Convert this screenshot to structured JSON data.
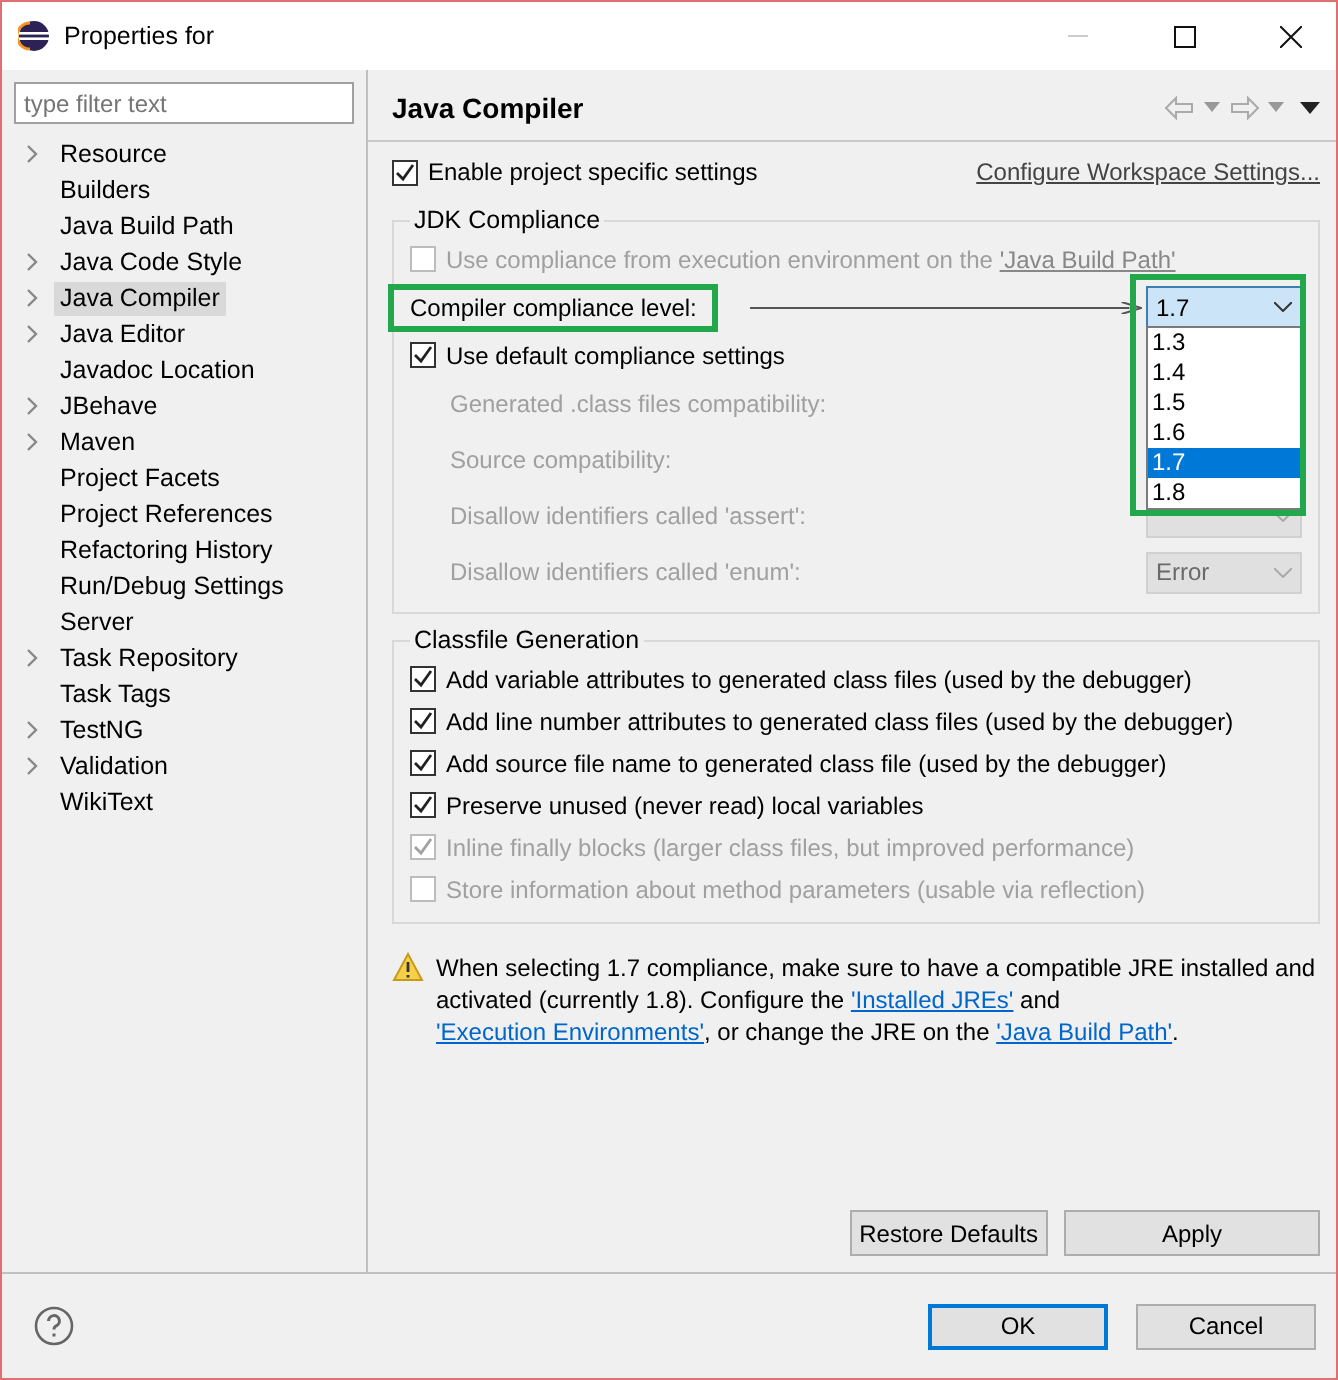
{
  "window": {
    "title": "Properties for"
  },
  "filter": {
    "placeholder": "type filter text"
  },
  "sidebar": {
    "items": [
      {
        "label": "Resource",
        "expandable": true,
        "selected": false
      },
      {
        "label": "Builders",
        "expandable": false,
        "selected": false
      },
      {
        "label": "Java Build Path",
        "expandable": false,
        "selected": false
      },
      {
        "label": "Java Code Style",
        "expandable": true,
        "selected": false
      },
      {
        "label": "Java Compiler",
        "expandable": true,
        "selected": true
      },
      {
        "label": "Java Editor",
        "expandable": true,
        "selected": false
      },
      {
        "label": "Javadoc Location",
        "expandable": false,
        "selected": false
      },
      {
        "label": "JBehave",
        "expandable": true,
        "selected": false
      },
      {
        "label": "Maven",
        "expandable": true,
        "selected": false
      },
      {
        "label": "Project Facets",
        "expandable": false,
        "selected": false
      },
      {
        "label": "Project References",
        "expandable": false,
        "selected": false
      },
      {
        "label": "Refactoring History",
        "expandable": false,
        "selected": false
      },
      {
        "label": "Run/Debug Settings",
        "expandable": false,
        "selected": false
      },
      {
        "label": "Server",
        "expandable": false,
        "selected": false
      },
      {
        "label": "Task Repository",
        "expandable": true,
        "selected": false
      },
      {
        "label": "Task Tags",
        "expandable": false,
        "selected": false
      },
      {
        "label": "TestNG",
        "expandable": true,
        "selected": false
      },
      {
        "label": "Validation",
        "expandable": true,
        "selected": false
      },
      {
        "label": "WikiText",
        "expandable": false,
        "selected": false
      }
    ]
  },
  "page": {
    "title": "Java Compiler",
    "enable": {
      "label": "Enable project specific settings",
      "checked": true
    },
    "configure_link": "Configure Workspace Settings...",
    "jdk_compliance": {
      "title": "JDK Compliance",
      "use_execution_env": {
        "label": "Use compliance from execution environment on the ",
        "link": "'Java Build Path'",
        "checked": false,
        "disabled": true
      },
      "compliance_level": {
        "label": "Compiler compliance level:",
        "value": "1.7",
        "expanded": true,
        "options": [
          {
            "label": "1.3",
            "selected": false
          },
          {
            "label": "1.4",
            "selected": false
          },
          {
            "label": "1.5",
            "selected": false
          },
          {
            "label": "1.6",
            "selected": false
          },
          {
            "label": "1.7",
            "selected": true
          },
          {
            "label": "1.8",
            "selected": false
          }
        ]
      },
      "use_default": {
        "label": "Use default compliance settings",
        "checked": true
      },
      "settings": [
        {
          "kind": "label",
          "label": "Generated .class files compatibility:",
          "disabled": true
        },
        {
          "kind": "label",
          "label": "Source compatibility:",
          "disabled": true
        },
        {
          "kind": "dropdown",
          "label": "Disallow identifiers called 'assert':",
          "disabled": true
        },
        {
          "kind": "dropdown",
          "label": "Disallow identifiers called 'enum':",
          "disabled": true,
          "value": "Error"
        }
      ]
    },
    "classfile_generation": {
      "title": "Classfile Generation",
      "options": [
        {
          "label": "Add variable attributes to generated class files (used by the debugger)",
          "checked": true,
          "disabled": false
        },
        {
          "label": "Add line number attributes to generated class files (used by the debugger)",
          "checked": true,
          "disabled": false
        },
        {
          "label": "Add source file name to generated class file (used by the debugger)",
          "checked": true,
          "disabled": false
        },
        {
          "label": "Preserve unused (never read) local variables",
          "checked": true,
          "disabled": false
        },
        {
          "label": "Inline finally blocks (larger class files, but improved performance)",
          "checked": true,
          "disabled": true
        },
        {
          "label": "Store information about method parameters (usable via reflection)",
          "checked": false,
          "disabled": true
        }
      ]
    },
    "warning": [
      {
        "kind": "text",
        "text": "When selecting 1.7 compliance, make sure to have a compatible JRE installed and activated (currently 1.8). Configure the "
      },
      {
        "kind": "link",
        "text": "'Installed JREs'"
      },
      {
        "kind": "text",
        "text": " and "
      },
      {
        "kind": "link",
        "text": "'Execution Environments'"
      },
      {
        "kind": "text",
        "text": ", or change the JRE on the "
      },
      {
        "kind": "link",
        "text": "'Java Build Path'"
      },
      {
        "kind": "text",
        "text": "."
      }
    ],
    "buttons": [
      "Restore Defaults",
      "Apply"
    ]
  },
  "dialog_buttons": [
    {
      "label": "OK",
      "default": true
    },
    {
      "label": "Cancel",
      "default": false
    }
  ]
}
